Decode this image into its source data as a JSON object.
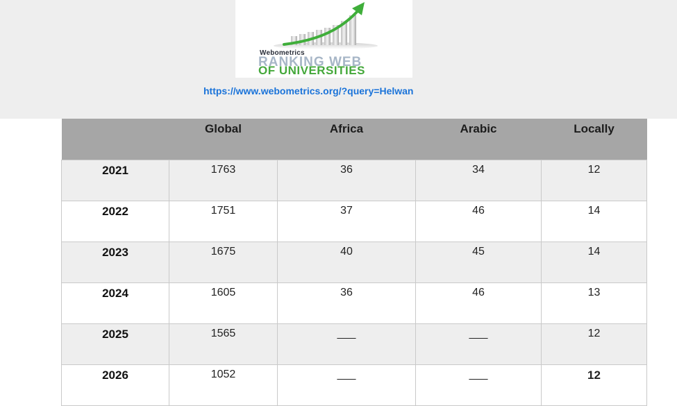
{
  "logo": {
    "small_text": "Webometrics",
    "title_line1": "RANKING WEB",
    "title_line2": "OF UNIVERSITIES"
  },
  "link": {
    "url_text": "https://www.webometrics.org/?query=Helwan"
  },
  "table": {
    "headers": [
      "",
      "Global",
      "Africa",
      "Arabic",
      "Locally"
    ],
    "rows": [
      {
        "year": "2021",
        "global": "1763",
        "africa": "36",
        "arabic": "34",
        "locally": "12"
      },
      {
        "year": "2022",
        "global": "1751",
        "africa": "37",
        "arabic": "46",
        "locally": "14"
      },
      {
        "year": "2023",
        "global": "1675",
        "africa": "40",
        "arabic": "45",
        "locally": "14"
      },
      {
        "year": "2024",
        "global": "1605",
        "africa": "36",
        "arabic": "46",
        "locally": "13"
      },
      {
        "year": "2025",
        "global": "1565",
        "africa": "___",
        "arabic": "___",
        "locally": "12"
      },
      {
        "year": "2026",
        "global": "1052",
        "africa": "___",
        "arabic": "___",
        "locally": "12"
      }
    ]
  },
  "colors": {
    "header_bg": "#eeeeee",
    "table_header_bg": "#a6a6a6",
    "link": "#1a73d9",
    "logo_green": "#44a83a",
    "logo_grey": "#a7b6c7"
  }
}
